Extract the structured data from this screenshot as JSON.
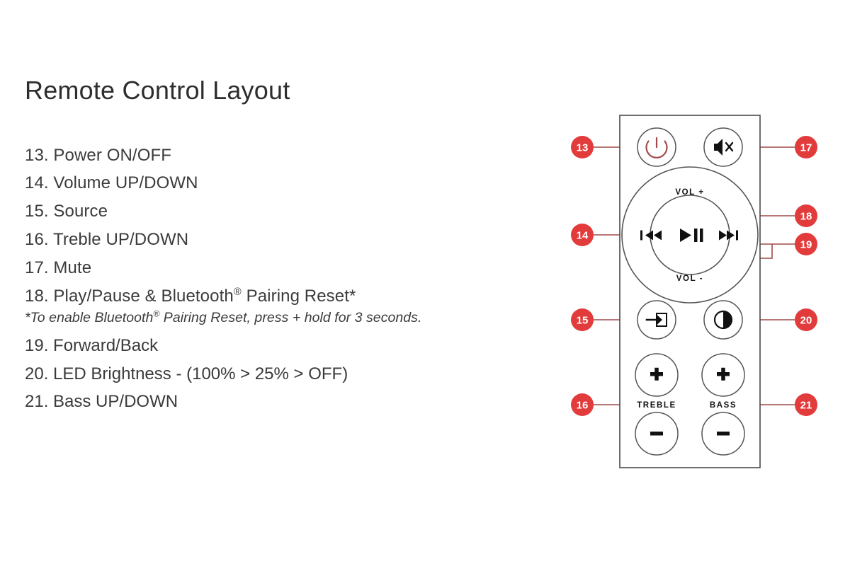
{
  "page": {
    "title": "Remote Control Layout",
    "background_color": "#ffffff",
    "text_color": "#3b3b3b"
  },
  "features": [
    {
      "number": "13.",
      "text": "Power ON/OFF"
    },
    {
      "number": "14.",
      "text": "Volume UP/DOWN"
    },
    {
      "number": "15.",
      "text": "Source"
    },
    {
      "number": "16.",
      "text": "Treble UP/DOWN"
    },
    {
      "number": "17.",
      "text": "Mute"
    },
    {
      "number": "18.",
      "text": "Play/Pause & Bluetooth® Pairing Reset*"
    },
    {
      "number": "19.",
      "text": "Forward/Back"
    },
    {
      "number": "20.",
      "text": "LED Brightness - (100% > 25% > OFF)"
    },
    {
      "number": "21.",
      "text": "Bass UP/DOWN"
    }
  ],
  "list_items": {
    "item13": "13. Power ON/OFF",
    "item14": "14. Volume UP/DOWN",
    "item15": "15. Source",
    "item16": "16. Treble UP/DOWN",
    "item17": "17. Mute",
    "item18_prefix": "18. Play/Pause & Bluetooth",
    "item18_sup": "®",
    "item18_suffix": " Pairing Reset*",
    "item19": "19. Forward/Back",
    "item20": "20. LED Brightness - (100% > 25% > OFF)",
    "item21": "21. Bass UP/DOWN"
  },
  "footnote": {
    "prefix": "*To enable Bluetooth",
    "sup": "®",
    "suffix": " Pairing Reset, press + hold for 3 seconds."
  },
  "diagram": {
    "button_labels": {
      "vol_up": "VOL +",
      "vol_down": "VOL -",
      "treble": "TREBLE",
      "bass": "BASS"
    },
    "callouts": {
      "c13": "13",
      "c14": "14",
      "c15": "15",
      "c16": "16",
      "c17": "17",
      "c18": "18",
      "c19": "19",
      "c20": "20",
      "c21": "21"
    },
    "icons": {
      "power": "power-icon",
      "mute": "mute-speaker-icon",
      "play_pause": "play-pause-icon",
      "previous": "previous-track-icon",
      "next": "next-track-icon",
      "source": "source-input-icon",
      "brightness": "led-brightness-icon",
      "treble_up": "plus-icon",
      "treble_down": "minus-icon",
      "bass_up": "plus-icon",
      "bass_down": "minus-icon"
    },
    "colors": {
      "callout_red": "#e23b3b",
      "leader_line": "#9e4a4a",
      "power_symbol": "#a04a4a",
      "body_outline": "#4a4a4a",
      "button_outline": "#555555",
      "icon_black": "#111111"
    }
  }
}
